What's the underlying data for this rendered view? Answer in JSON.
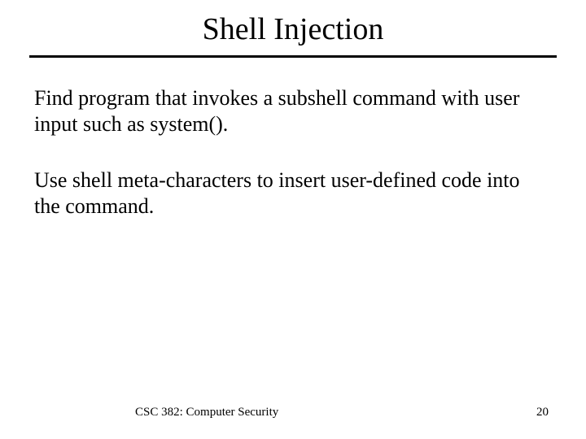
{
  "title": "Shell Injection",
  "paragraph1": "Find program that invokes a subshell command with user input such as system().",
  "paragraph2": "Use shell meta-characters to insert user-defined code into the command.",
  "footer": {
    "course": "CSC 382: Computer Security",
    "page": "20"
  }
}
